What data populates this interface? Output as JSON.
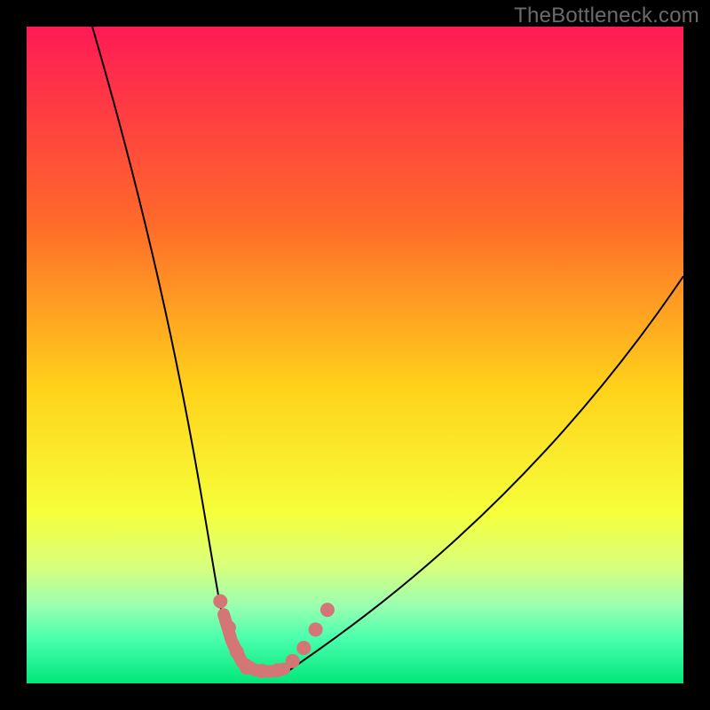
{
  "watermark": "TheBottleneck.com",
  "chart_data": {
    "type": "line",
    "title": "",
    "xlabel": "",
    "ylabel": "",
    "xlim": [
      0,
      100
    ],
    "ylim": [
      0,
      100
    ],
    "gradient_stops": [
      {
        "offset": 0,
        "color": "#ff1a55"
      },
      {
        "offset": 0.3,
        "color": "#ff6a2a"
      },
      {
        "offset": 0.55,
        "color": "#ffd21a"
      },
      {
        "offset": 0.74,
        "color": "#f6ff3a"
      },
      {
        "offset": 0.82,
        "color": "#d9ff7a"
      },
      {
        "offset": 0.88,
        "color": "#9cffb0"
      },
      {
        "offset": 0.93,
        "color": "#4cffad"
      },
      {
        "offset": 1.0,
        "color": "#00e77a"
      }
    ],
    "series": [
      {
        "name": "left-curve",
        "type": "bezier",
        "stroke": "#000000",
        "stroke_width": 2.0,
        "points": {
          "start": [
            10,
            100
          ],
          "c1": [
            29,
            35
          ],
          "c2": [
            28,
            5
          ],
          "end": [
            33,
            2
          ]
        }
      },
      {
        "name": "right-curve",
        "type": "bezier",
        "stroke": "#000000",
        "stroke_width": 2.0,
        "points": {
          "start": [
            40,
            2
          ],
          "c1": [
            47,
            7
          ],
          "c2": [
            75,
            25
          ],
          "end": [
            100,
            62
          ]
        }
      }
    ],
    "overlay_dots": {
      "color": "#d47676",
      "r": 8,
      "points": [
        [
          29.5,
          12.5
        ],
        [
          30.8,
          8.5
        ],
        [
          32.0,
          4.8
        ],
        [
          33.5,
          2.4
        ],
        [
          35.8,
          1.9
        ],
        [
          38.2,
          2.0
        ],
        [
          40.5,
          3.4
        ],
        [
          42.2,
          5.4
        ],
        [
          44.0,
          8.2
        ],
        [
          45.8,
          11.2
        ]
      ]
    },
    "overlay_band": {
      "color": "#d47676",
      "thickness": 14,
      "path": [
        [
          30.0,
          10.5
        ],
        [
          31.2,
          6.5
        ],
        [
          32.8,
          3.2
        ],
        [
          34.8,
          2.0
        ],
        [
          37.0,
          1.8
        ],
        [
          39.2,
          2.2
        ]
      ]
    }
  }
}
